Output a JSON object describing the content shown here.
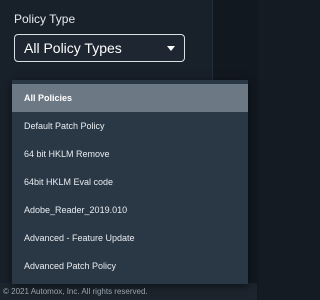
{
  "filter": {
    "label": "Policy Type",
    "selected_value": "All Policy Types",
    "caret_icon": "caret-down-icon"
  },
  "dropdown": {
    "options": [
      {
        "label": "All Policies",
        "selected": true
      },
      {
        "label": "Default Patch Policy",
        "selected": false
      },
      {
        "label": "64 bit HKLM Remove",
        "selected": false
      },
      {
        "label": "64bit HKLM Eval code",
        "selected": false
      },
      {
        "label": "Adobe_Reader_2019.010",
        "selected": false
      },
      {
        "label": "Advanced - Feature Update",
        "selected": false
      },
      {
        "label": "Advanced Patch Policy",
        "selected": false
      }
    ]
  },
  "footer": {
    "copyright": "© 2021 Automox, Inc. All rights reserved."
  }
}
